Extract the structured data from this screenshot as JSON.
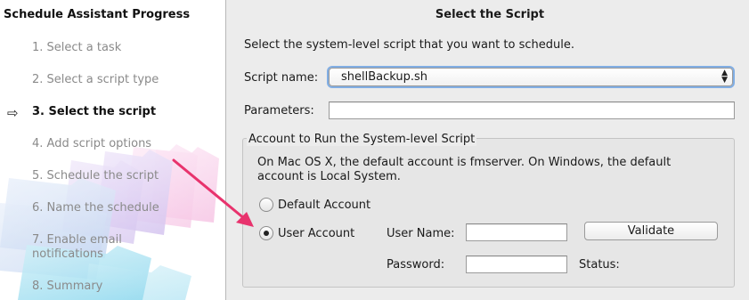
{
  "sidebar": {
    "title": "Schedule Assistant Progress",
    "steps": [
      {
        "label": "1. Select a task"
      },
      {
        "label": "2. Select a script type"
      },
      {
        "label": "3. Select the script"
      },
      {
        "label": "4. Add script options"
      },
      {
        "label": "5. Schedule the script"
      },
      {
        "label": "6. Name the schedule"
      },
      {
        "label": "7. Enable email notifications"
      },
      {
        "label": "8. Summary"
      }
    ],
    "active_step": 3
  },
  "main": {
    "title": "Select the Script",
    "instructions": "Select the system-level script that you want to schedule.",
    "script_name": {
      "label": "Script name:",
      "value": "shellBackup.sh"
    },
    "parameters": {
      "label": "Parameters:",
      "value": ""
    },
    "account_group": {
      "legend": "Account to Run the System-level Script",
      "info": "On Mac OS X, the default account is fmserver. On Windows, the default account is Local System.",
      "default_account": {
        "label": "Default Account",
        "selected": false
      },
      "user_account": {
        "label": "User Account",
        "selected": true
      },
      "user_name": {
        "label": "User Name:",
        "value": ""
      },
      "password": {
        "label": "Password:",
        "value": ""
      },
      "status": {
        "label": "Status:",
        "value": ""
      },
      "validate_button": "Validate"
    }
  },
  "colors": {
    "focus_ring": "#5d99e2",
    "annotation_arrow": "#e8336d"
  },
  "icons": {
    "current_step": "arrow-right-icon",
    "select_chevrons": "up-down-chevron-icon"
  }
}
